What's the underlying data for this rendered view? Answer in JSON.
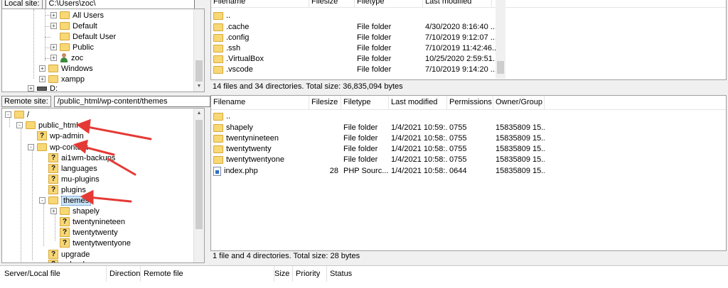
{
  "local": {
    "site_label": "Local site:",
    "path": "C:\\Users\\zoc\\",
    "tree": [
      {
        "label": "All Users",
        "icon": "folder",
        "expander": "+"
      },
      {
        "label": "Default",
        "icon": "folder",
        "expander": "+"
      },
      {
        "label": "Default User",
        "icon": "folder",
        "expander": ""
      },
      {
        "label": "Public",
        "icon": "folder",
        "expander": "+"
      },
      {
        "label": "zoc",
        "icon": "user",
        "expander": "+"
      },
      {
        "label": "Windows",
        "icon": "folder",
        "expander": "+"
      },
      {
        "label": "xampp",
        "icon": "folder",
        "expander": "+"
      },
      {
        "label": "D:",
        "icon": "drive",
        "expander": "+"
      }
    ],
    "headers": {
      "filename": "Filename",
      "filesize": "Filesize",
      "filetype": "Filetype",
      "modified": "Last modified"
    },
    "files": [
      {
        "name": "..",
        "size": "",
        "type": "",
        "modified": ""
      },
      {
        "name": ".cache",
        "size": "",
        "type": "File folder",
        "modified": "4/30/2020 8:16:40 ..."
      },
      {
        "name": ".config",
        "size": "",
        "type": "File folder",
        "modified": "7/10/2019 9:12:07 ..."
      },
      {
        "name": ".ssh",
        "size": "",
        "type": "File folder",
        "modified": "7/10/2019 11:42:46..."
      },
      {
        "name": ".VirtualBox",
        "size": "",
        "type": "File folder",
        "modified": "10/25/2020 2:59:51..."
      },
      {
        "name": ".vscode",
        "size": "",
        "type": "File folder",
        "modified": "7/10/2019 9:14:20 ..."
      }
    ],
    "status": "14 files and 34 directories. Total size: 36,835,094 bytes"
  },
  "remote": {
    "site_label": "Remote site:",
    "path": "/public_html/wp-content/themes",
    "tree": [
      {
        "label": "/",
        "icon": "folder",
        "expander": "-"
      },
      {
        "label": "public_html",
        "icon": "folder",
        "expander": "-"
      },
      {
        "label": "wp-admin",
        "icon": "qfolder",
        "expander": ""
      },
      {
        "label": "wp-content",
        "icon": "folder",
        "expander": "-"
      },
      {
        "label": "ai1wm-backups",
        "icon": "qfolder",
        "expander": ""
      },
      {
        "label": "languages",
        "icon": "qfolder",
        "expander": ""
      },
      {
        "label": "mu-plugins",
        "icon": "qfolder",
        "expander": ""
      },
      {
        "label": "plugins",
        "icon": "qfolder",
        "expander": ""
      },
      {
        "label": "themes",
        "icon": "folder",
        "expander": "-"
      },
      {
        "label": "shapely",
        "icon": "folder",
        "expander": "+"
      },
      {
        "label": "twentynineteen",
        "icon": "qfolder",
        "expander": ""
      },
      {
        "label": "twentytwenty",
        "icon": "qfolder",
        "expander": ""
      },
      {
        "label": "twentytwentyone",
        "icon": "qfolder",
        "expander": ""
      },
      {
        "label": "upgrade",
        "icon": "qfolder",
        "expander": ""
      },
      {
        "label": "uploads",
        "icon": "qfolder",
        "expander": ""
      }
    ],
    "headers": {
      "filename": "Filename",
      "filesize": "Filesize",
      "filetype": "Filetype",
      "modified": "Last modified",
      "permissions": "Permissions",
      "owner": "Owner/Group"
    },
    "files": [
      {
        "name": "..",
        "size": "",
        "type": "",
        "modified": "",
        "perm": "",
        "owner": "",
        "icon": "folder"
      },
      {
        "name": "shapely",
        "size": "",
        "type": "File folder",
        "modified": "1/4/2021 10:59:...",
        "perm": "0755",
        "owner": "15835809 15...",
        "icon": "folder"
      },
      {
        "name": "twentynineteen",
        "size": "",
        "type": "File folder",
        "modified": "1/4/2021 10:58:...",
        "perm": "0755",
        "owner": "15835809 15...",
        "icon": "folder"
      },
      {
        "name": "twentytwenty",
        "size": "",
        "type": "File folder",
        "modified": "1/4/2021 10:58:...",
        "perm": "0755",
        "owner": "15835809 15...",
        "icon": "folder"
      },
      {
        "name": "twentytwentyone",
        "size": "",
        "type": "File folder",
        "modified": "1/4/2021 10:58:...",
        "perm": "0755",
        "owner": "15835809 15...",
        "icon": "folder"
      },
      {
        "name": "index.php",
        "size": "28",
        "type": "PHP Sourc...",
        "modified": "1/4/2021 10:58:...",
        "perm": "0644",
        "owner": "15835809 15...",
        "icon": "php"
      }
    ],
    "status": "1 file and 4 directories. Total size: 28 bytes"
  },
  "queue": {
    "server_local": "Server/Local file",
    "direction": "Direction",
    "remote_file": "Remote file",
    "size": "Size",
    "priority": "Priority",
    "status": "Status"
  },
  "colors": {
    "annotation_arrow": "#e53935",
    "folder": "#f8d775",
    "selection": "#cce4f7"
  }
}
